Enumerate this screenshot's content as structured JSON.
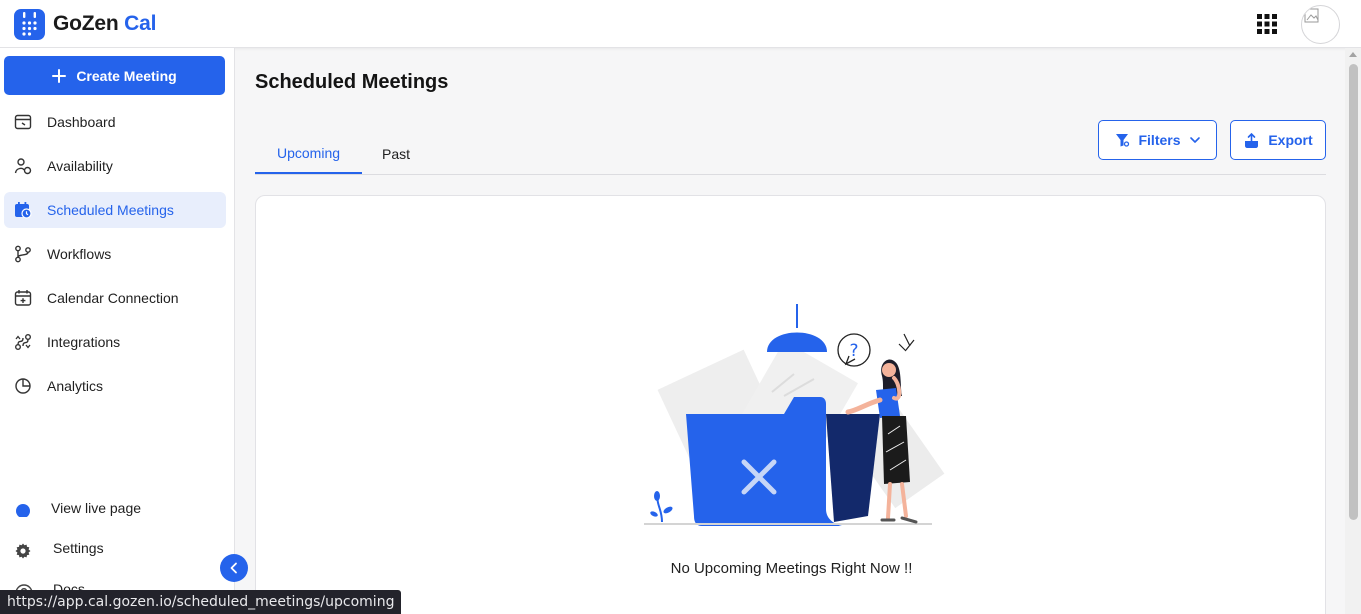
{
  "brand": {
    "name_part1": "GoZen",
    "name_part2": "Cal",
    "accent": "#2563eb"
  },
  "sidebar": {
    "create_label": "Create Meeting",
    "items": [
      {
        "label": "Dashboard",
        "icon": "dashboard-icon"
      },
      {
        "label": "Availability",
        "icon": "availability-icon"
      },
      {
        "label": "Scheduled Meetings",
        "icon": "calendar-clock-icon",
        "active": true
      },
      {
        "label": "Workflows",
        "icon": "workflow-icon"
      },
      {
        "label": "Calendar Connection",
        "icon": "calendar-plus-icon"
      },
      {
        "label": "Integrations",
        "icon": "integrations-icon"
      },
      {
        "label": "Analytics",
        "icon": "pie-chart-icon"
      }
    ],
    "bottom": {
      "live_page": "View live page",
      "settings": "Settings",
      "docs": "Docs"
    }
  },
  "main": {
    "title": "Scheduled Meetings",
    "tabs": [
      {
        "label": "Upcoming",
        "active": true
      },
      {
        "label": "Past"
      }
    ],
    "filters_label": "Filters",
    "export_label": "Export",
    "empty_message": "No Upcoming Meetings Right Now !!"
  },
  "status_bar": {
    "url": "https://app.cal.gozen.io/scheduled_meetings/upcoming"
  }
}
